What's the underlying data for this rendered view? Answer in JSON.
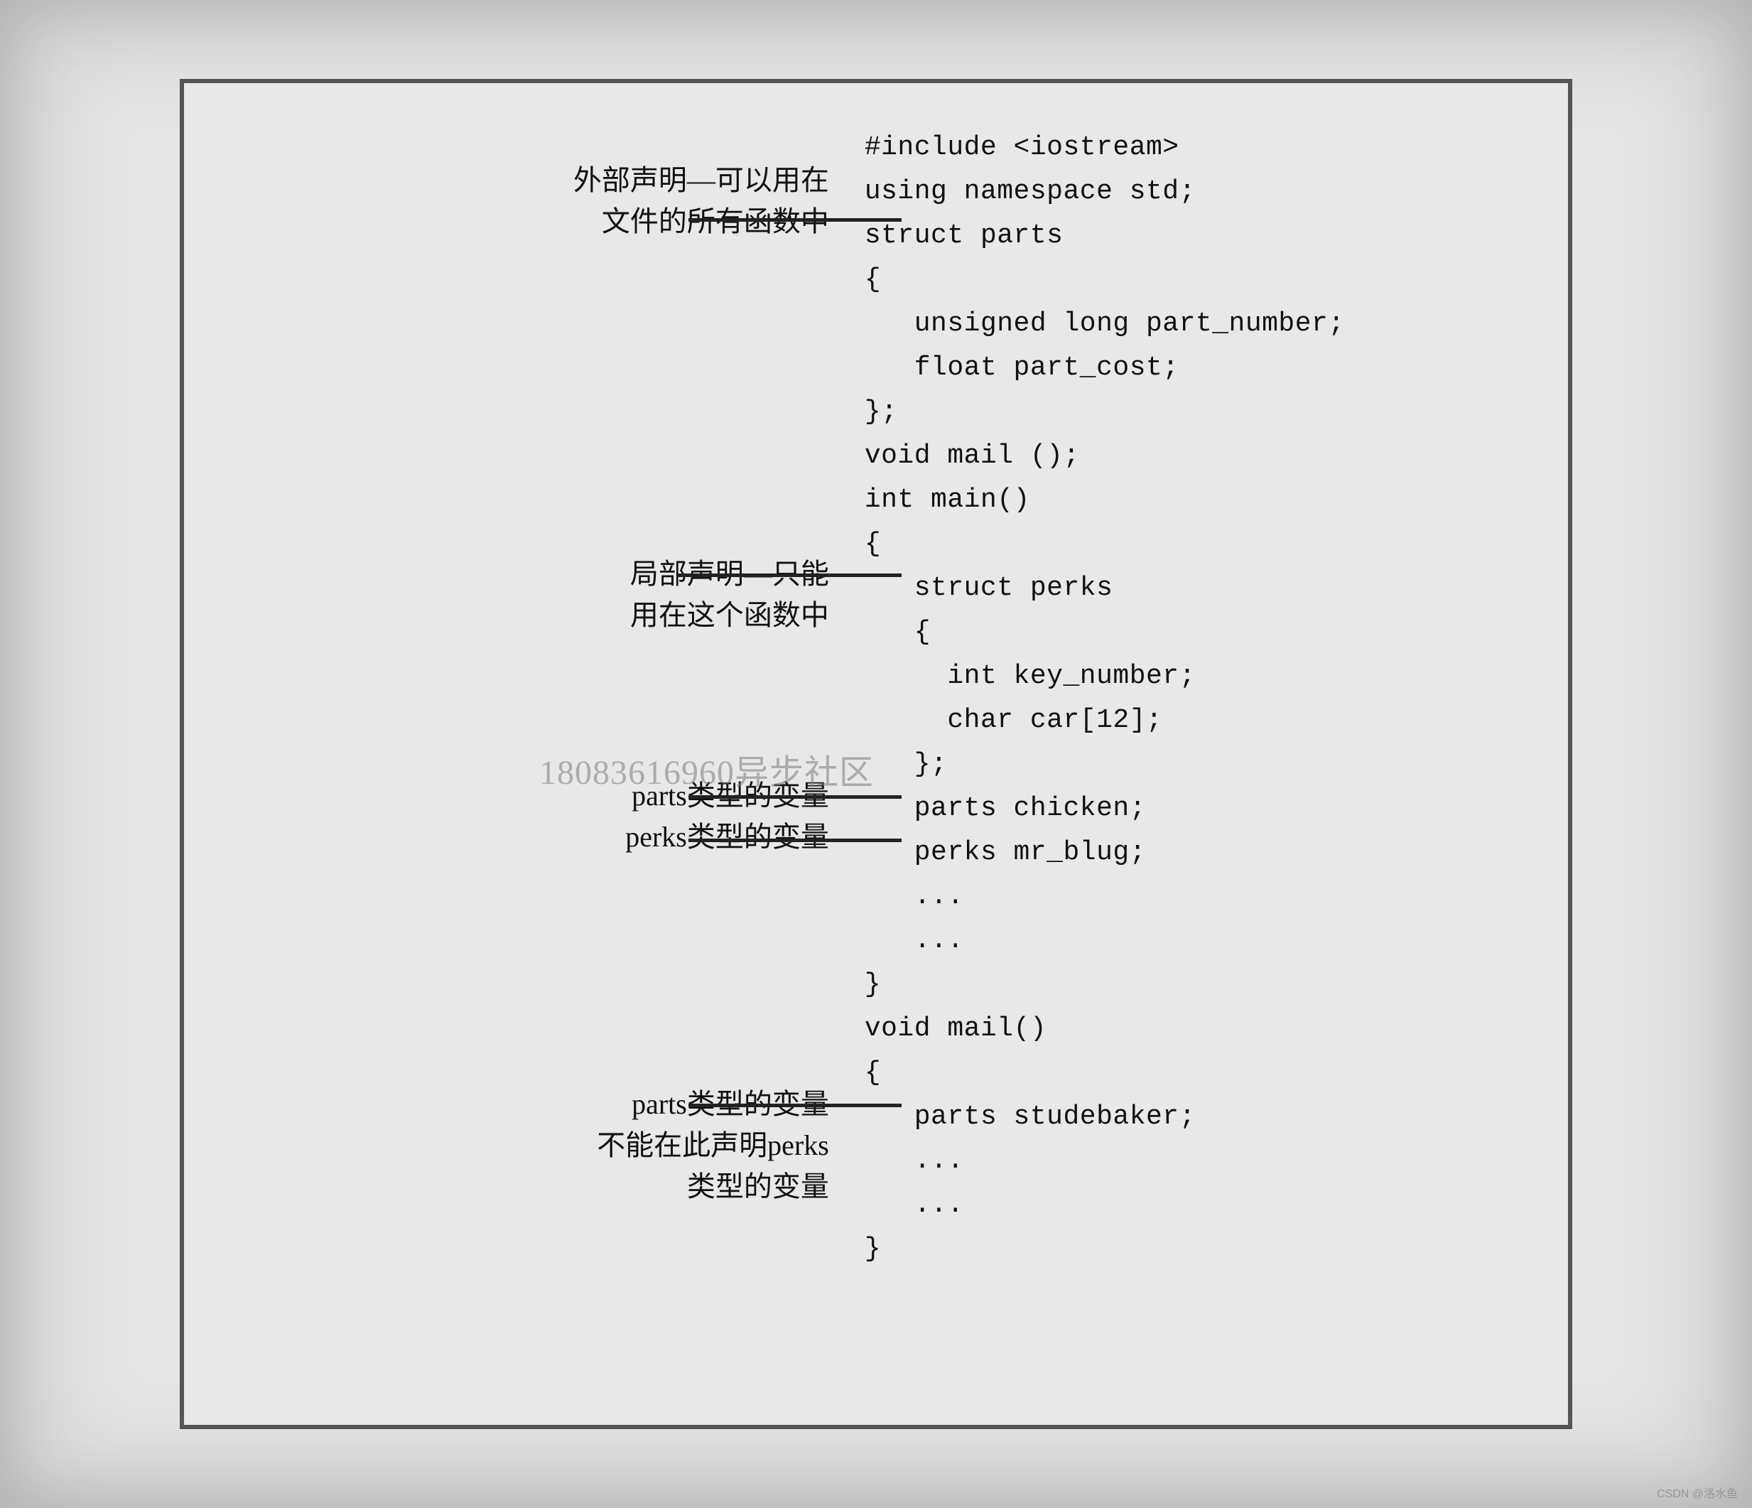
{
  "annotations": {
    "a1_l1": "外部声明—可以用在",
    "a1_l2": "文件的所有函数中",
    "a2_l1": "局部声明—只能",
    "a2_l2": "用在这个函数中",
    "a3_l1": "parts类型的变量",
    "a3_l2": "perks类型的变量",
    "a4_l1": "parts类型的变量",
    "a4_l2": "不能在此声明perks",
    "a4_l3": "类型的变量"
  },
  "code": {
    "l01": "#include <iostream>",
    "l02": "using namespace std;",
    "l03": "struct parts",
    "l04": "{",
    "l05": "   unsigned long part_number;",
    "l06": "   float part_cost;",
    "l07": "};",
    "l08": "void mail ();",
    "l09": "int main()",
    "l10": "{",
    "l11": "   struct perks",
    "l12": "   {",
    "l13": "     int key_number;",
    "l14": "     char car[12];",
    "l15": "   };",
    "l16": "   parts chicken;",
    "l17": "   perks mr_blug;",
    "l18": "   ...",
    "l19": "   ...",
    "l20": "}",
    "l21": "void mail()",
    "l22": "{",
    "l23": "   parts studebaker;",
    "l24": "   ...",
    "l25": "   ...",
    "l26": "}"
  },
  "watermark": "18083616960异步社区",
  "bottom_mark": "CSDN @洛水鱼"
}
